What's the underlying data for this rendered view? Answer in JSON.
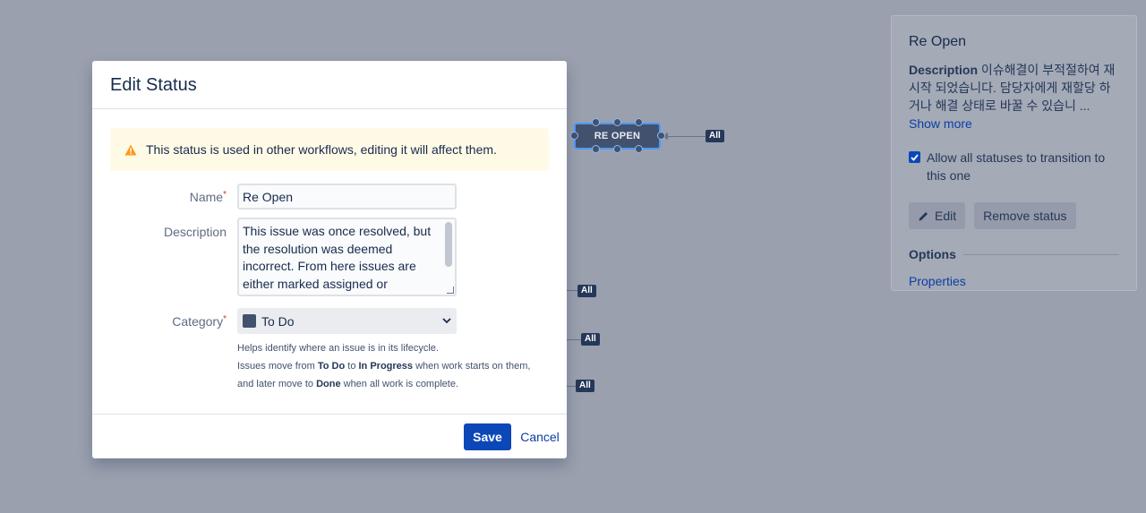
{
  "canvas": {
    "node_label": "RE OPEN",
    "transition_tag": "All"
  },
  "side_panel": {
    "title": "Re Open",
    "description_label": "Description",
    "description_text": " 이슈해결이 부적절하여 재시작 되었습니다. 담당자에게 재할당 하거나 해결 상태로 바꿀 수 있습니 ",
    "ellipsis": "...",
    "show_more": "Show more",
    "allow_all_label": "Allow all statuses to transition to this one",
    "allow_all_checked": true,
    "edit_button": "Edit",
    "remove_button": "Remove status",
    "options_heading": "Options",
    "properties_link": "Properties"
  },
  "modal": {
    "title": "Edit Status",
    "warning": "This status is used in other workflows, editing it will affect them.",
    "name_label": "Name",
    "name_value": "Re Open",
    "description_label": "Description",
    "description_value": "This issue was once resolved, but the resolution was deemed incorrect. From here issues are either marked assigned or",
    "category_label": "Category",
    "category_value": "To Do",
    "help_line1": "Helps identify where an issue is in its lifecycle.",
    "help_line2_a": "Issues move from ",
    "help_todo": "To Do",
    "help_line2_b": " to ",
    "help_inprogress": "In Progress",
    "help_line2_c": " when work starts on them,",
    "help_line3_a": "and later move to ",
    "help_done": "Done",
    "help_line3_b": " when all work is complete.",
    "save": "Save",
    "cancel": "Cancel"
  },
  "colors": {
    "primary": "#0c47b7",
    "warning_bg": "#fffae6",
    "warning_icon": "#ff991f",
    "node_bg": "#42526e",
    "overlay": "#9aa0ae"
  }
}
